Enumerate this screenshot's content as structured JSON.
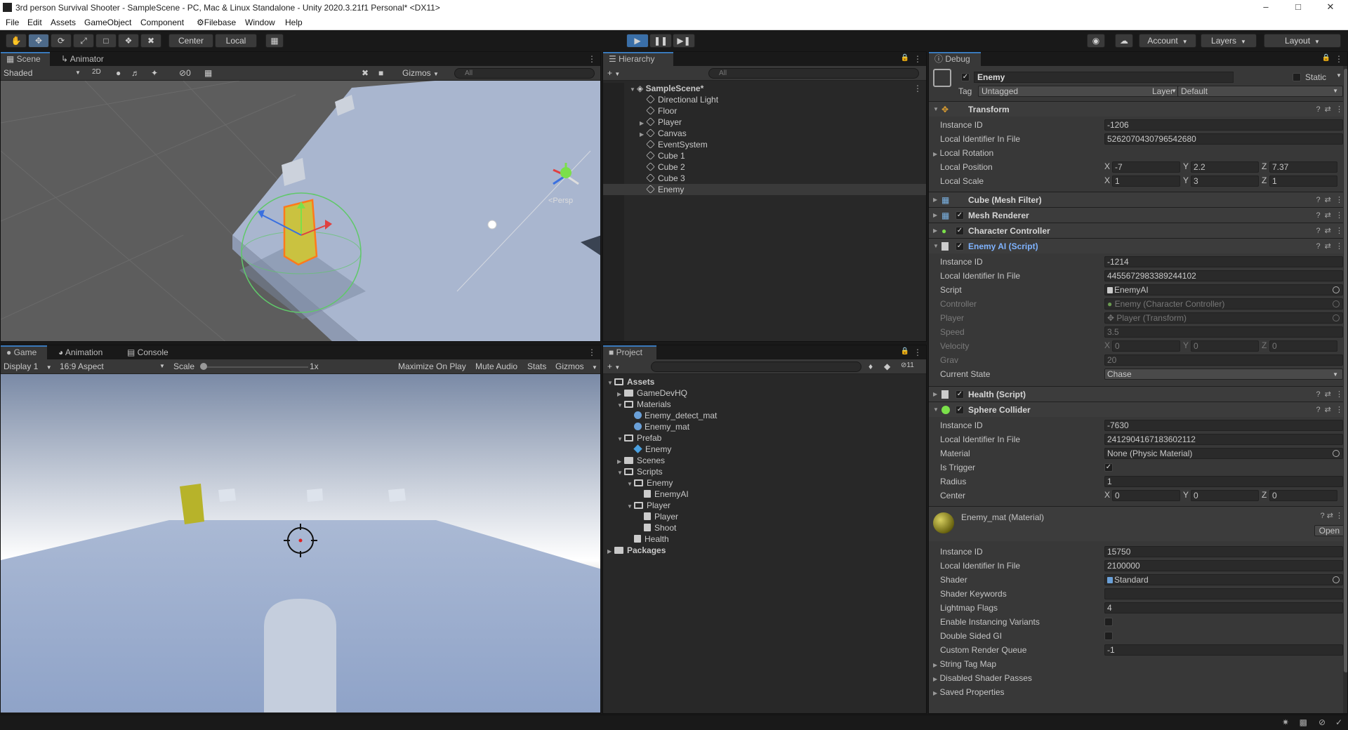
{
  "window": {
    "title": "3rd person Survival Shooter - SampleScene - PC, Mac & Linux Standalone - Unity 2020.3.21f1 Personal* <DX11>"
  },
  "menu": [
    "File",
    "Edit",
    "Assets",
    "GameObject",
    "Component",
    "Filebase",
    "Window",
    "Help"
  ],
  "toolbar": {
    "pivot": "Center",
    "space": "Local",
    "account": "Account",
    "layers": "Layers",
    "layout": "Layout"
  },
  "scene_panel": {
    "tabs": [
      "Scene",
      "Animator"
    ],
    "shading": "Shaded",
    "mode_2d": "2D",
    "hidden_count": "0",
    "gizmos": "Gizmos",
    "search_placeholder": "All",
    "persp_label": "<Persp"
  },
  "game_panel": {
    "tabs": [
      "Game",
      "Animation",
      "Console"
    ],
    "display": "Display 1",
    "aspect": "16:9 Aspect",
    "scale_label": "Scale",
    "scale_value": "1x",
    "maximize": "Maximize On Play",
    "mute": "Mute Audio",
    "stats": "Stats",
    "gizmos": "Gizmos"
  },
  "hierarchy": {
    "tab": "Hierarchy",
    "search_placeholder": "All",
    "scene": "SampleScene*",
    "items": [
      {
        "name": "Directional Light",
        "expandable": false
      },
      {
        "name": "Floor",
        "expandable": false
      },
      {
        "name": "Player",
        "expandable": true
      },
      {
        "name": "Canvas",
        "expandable": true
      },
      {
        "name": "EventSystem",
        "expandable": false
      },
      {
        "name": "Cube 1",
        "expandable": false
      },
      {
        "name": "Cube 2",
        "expandable": false
      },
      {
        "name": "Cube 3",
        "expandable": false
      },
      {
        "name": "Enemy",
        "expandable": false
      }
    ]
  },
  "project": {
    "tab": "Project",
    "hidden_count": "11",
    "tree": [
      {
        "label": "Assets",
        "depth": 0,
        "type": "folder-open",
        "bold": true
      },
      {
        "label": "GameDevHQ",
        "depth": 1,
        "type": "folder"
      },
      {
        "label": "Materials",
        "depth": 1,
        "type": "folder-open"
      },
      {
        "label": "Enemy_detect_mat",
        "depth": 2,
        "type": "material"
      },
      {
        "label": "Enemy_mat",
        "depth": 2,
        "type": "material"
      },
      {
        "label": "Prefab",
        "depth": 1,
        "type": "folder-open"
      },
      {
        "label": "Enemy",
        "depth": 2,
        "type": "prefab"
      },
      {
        "label": "Scenes",
        "depth": 1,
        "type": "folder"
      },
      {
        "label": "Scripts",
        "depth": 1,
        "type": "folder-open"
      },
      {
        "label": "Enemy",
        "depth": 2,
        "type": "folder-open"
      },
      {
        "label": "EnemyAI",
        "depth": 3,
        "type": "script"
      },
      {
        "label": "Player",
        "depth": 2,
        "type": "folder-open"
      },
      {
        "label": "Player",
        "depth": 3,
        "type": "script"
      },
      {
        "label": "Shoot",
        "depth": 3,
        "type": "script"
      },
      {
        "label": "Health",
        "depth": 2,
        "type": "script"
      },
      {
        "label": "Packages",
        "depth": 0,
        "type": "folder",
        "bold": true
      }
    ]
  },
  "inspector": {
    "tab": "Debug",
    "object_name": "Enemy",
    "static_label": "Static",
    "tag_label": "Tag",
    "tag_value": "Untagged",
    "layer_label": "Layer",
    "layer_value": "Default",
    "transform": {
      "title": "Transform",
      "instance_id_label": "Instance ID",
      "instance_id": "-1206",
      "local_id_label": "Local Identifier In File",
      "local_id": "5262070430796542680",
      "local_rotation": "Local Rotation",
      "local_position_label": "Local Position",
      "pos": {
        "x": "-7",
        "y": "2.2",
        "z": "7.37"
      },
      "local_scale_label": "Local Scale",
      "scale": {
        "x": "1",
        "y": "3",
        "z": "1"
      }
    },
    "mesh_filter": "Cube (Mesh Filter)",
    "mesh_renderer": "Mesh Renderer",
    "character_controller": "Character Controller",
    "enemy_ai": {
      "title": "Enemy AI (Script)",
      "instance_id_label": "Instance ID",
      "instance_id": "-1214",
      "local_id_label": "Local Identifier In File",
      "local_id": "4455672983389244102",
      "script_label": "Script",
      "script": "EnemyAI",
      "controller_label": "Controller",
      "controller": "Enemy (Character Controller)",
      "player_label": "Player",
      "player": "Player (Transform)",
      "speed_label": "Speed",
      "speed": "3.5",
      "velocity_label": "Velocity",
      "velocity": {
        "x": "0",
        "y": "0",
        "z": "0"
      },
      "grav_label": "Grav",
      "grav": "20",
      "state_label": "Current State",
      "state": "Chase"
    },
    "health": "Health (Script)",
    "sphere_collider": {
      "title": "Sphere Collider",
      "instance_id_label": "Instance ID",
      "instance_id": "-7630",
      "local_id_label": "Local Identifier In File",
      "local_id": "2412904167183602112",
      "material_label": "Material",
      "material": "None (Physic Material)",
      "trigger_label": "Is Trigger",
      "radius_label": "Radius",
      "radius": "1",
      "center_label": "Center",
      "center": {
        "x": "0",
        "y": "0",
        "z": "0"
      }
    },
    "material": {
      "title": "Enemy_mat (Material)",
      "open": "Open",
      "instance_id_label": "Instance ID",
      "instance_id": "15750",
      "local_id_label": "Local Identifier In File",
      "local_id": "2100000",
      "shader_label": "Shader",
      "shader": "Standard",
      "keywords_label": "Shader Keywords",
      "lightmap_label": "Lightmap Flags",
      "lightmap": "4",
      "instancing_label": "Enable Instancing Variants",
      "double_sided_label": "Double Sided GI",
      "render_queue_label": "Custom Render Queue",
      "render_queue": "-1",
      "string_tag_map": "String Tag Map",
      "disabled_passes": "Disabled Shader Passes",
      "saved_props": "Saved Properties"
    }
  },
  "colors": {
    "accent": "#3a79bb",
    "panel": "#282828",
    "header": "#383838"
  }
}
